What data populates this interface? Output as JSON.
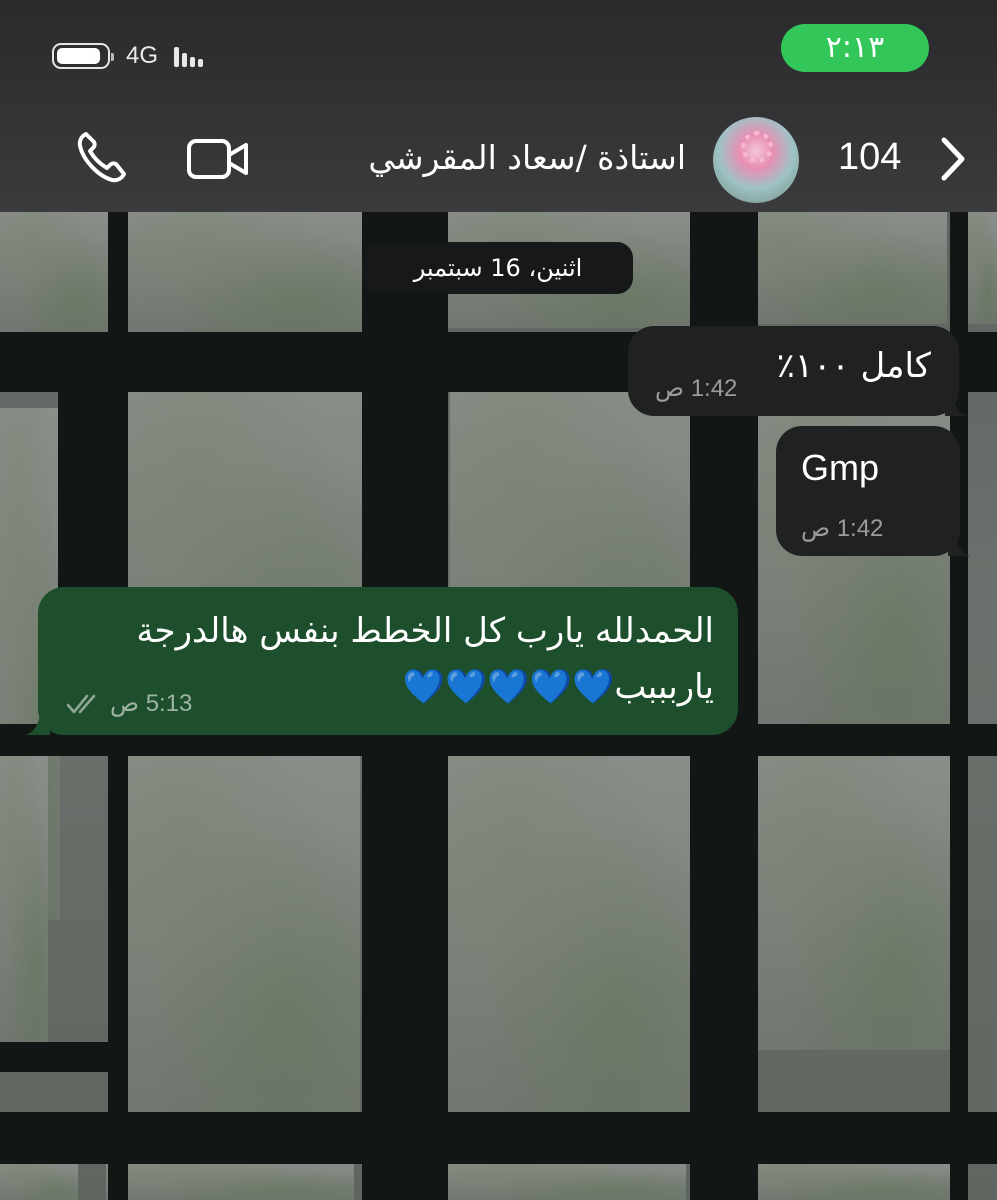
{
  "status_bar": {
    "network": "4G",
    "time": "٢:١٣"
  },
  "header": {
    "unread_count": "104",
    "contact_name": "استاذة /سعاد المقرشي"
  },
  "chat": {
    "date_chip": "اثنين، 16 سبتمبر",
    "messages": [
      {
        "direction": "incoming",
        "text": "كامل ١٠٠٪",
        "time": "1:42 ص"
      },
      {
        "direction": "incoming",
        "text": "Gmp",
        "time": "1:42 ص"
      },
      {
        "direction": "outgoing",
        "text_line1": "الحمدلله يارب كل الخطط بنفس هالدرجة",
        "text_line2": "ياربببب💙💙💙💙💙",
        "time": "5:13 ص",
        "status": "read"
      }
    ]
  },
  "colors": {
    "status_pill": "#33c75a",
    "outgoing_bubble": "#1d4f2c",
    "incoming_bubble": "#202121",
    "header_bg": "#333335"
  },
  "icons": [
    "chevron-left-icon",
    "phone-icon",
    "video-camera-icon",
    "battery-icon",
    "signal-icon",
    "double-check-icon",
    "heart-icon"
  ]
}
